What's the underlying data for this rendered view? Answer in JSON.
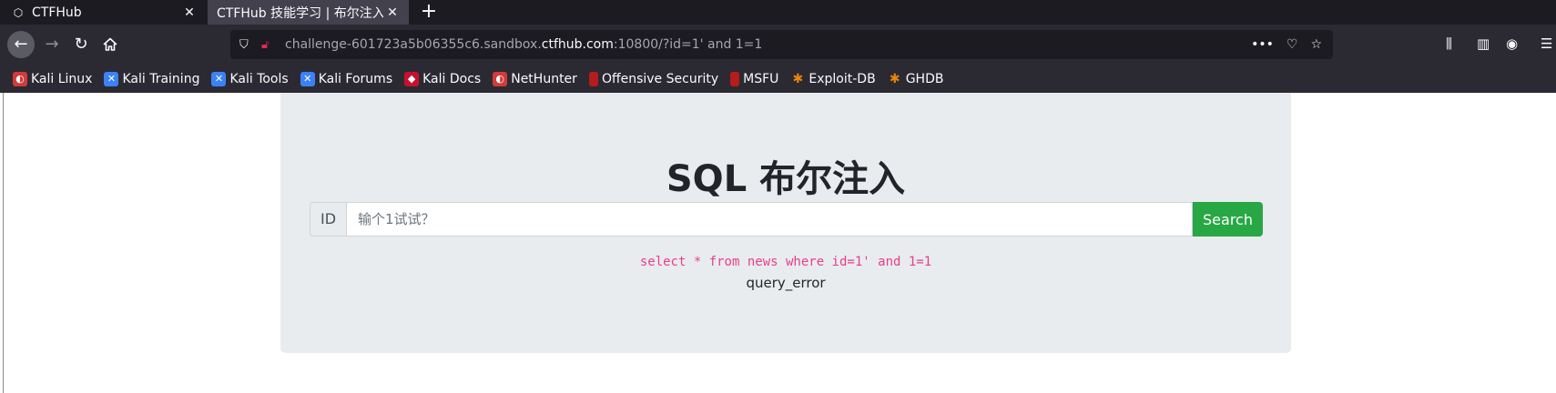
{
  "tabs": [
    {
      "title": "CTFHub",
      "favicon": "ctfhub-icon",
      "close": "✕"
    },
    {
      "title": "CTFHub 技能学习 | 布尔注入",
      "close": "✕"
    }
  ],
  "new_tab_label": "+",
  "url": {
    "prefix": "challenge-601723a5b06355c6.sandbox.",
    "host": "ctfhub.com",
    "suffix": ":10800/?id=1' and 1=1"
  },
  "bookmarks": [
    {
      "label": "Kali Linux",
      "icon": "kali-icon"
    },
    {
      "label": "Kali Training",
      "icon": "training-icon"
    },
    {
      "label": "Kali Tools",
      "icon": "tools-icon"
    },
    {
      "label": "Kali Forums",
      "icon": "forums-icon"
    },
    {
      "label": "Kali Docs",
      "icon": "docs-icon"
    },
    {
      "label": "NetHunter",
      "icon": "nethunter-icon"
    },
    {
      "label": "Offensive Security",
      "icon": "offsec-icon"
    },
    {
      "label": "MSFU",
      "icon": "msfu-icon"
    },
    {
      "label": "Exploit-DB",
      "icon": "exploitdb-icon"
    },
    {
      "label": "GHDB",
      "icon": "ghdb-icon"
    }
  ],
  "page": {
    "heading": "SQL 布尔注入",
    "input_prefix": "ID",
    "input_placeholder": "输个1试试？",
    "search_label": "Search",
    "sql": "select * from news where id=1' and 1=1",
    "result": "query_error"
  },
  "colors": {
    "search_button": "#28a745",
    "sql_text": "#e83e8c",
    "jumbotron_bg": "#e9ecef"
  }
}
